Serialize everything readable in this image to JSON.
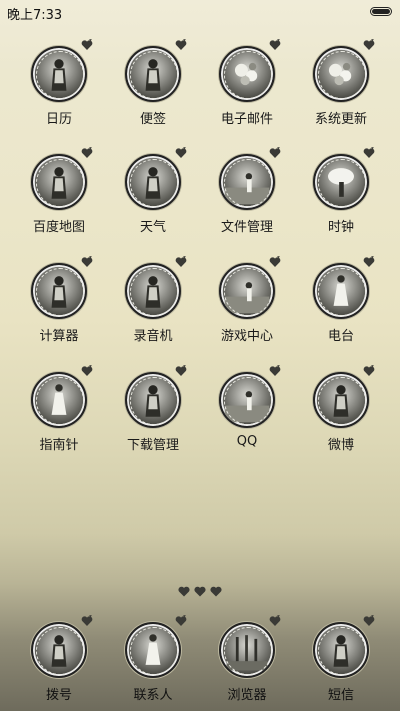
{
  "status_bar": {
    "time": "晚上7:33"
  },
  "apps": [
    {
      "label": "日历",
      "icon": "calendar-icon",
      "photo": "girl-portrait"
    },
    {
      "label": "便签",
      "icon": "notes-icon",
      "photo": "girl-portrait"
    },
    {
      "label": "电子邮件",
      "icon": "email-icon",
      "photo": "flowers"
    },
    {
      "label": "系统更新",
      "icon": "system-update-icon",
      "photo": "flower-closeup"
    },
    {
      "label": "百度地图",
      "icon": "baidu-map-icon",
      "photo": "girl-portrait"
    },
    {
      "label": "天气",
      "icon": "weather-icon",
      "photo": "girl-portrait"
    },
    {
      "label": "文件管理",
      "icon": "file-manager-icon",
      "photo": "girl-field"
    },
    {
      "label": "时钟",
      "icon": "clock-icon",
      "photo": "girl-umbrella"
    },
    {
      "label": "计算器",
      "icon": "calculator-icon",
      "photo": "girl-portrait"
    },
    {
      "label": "录音机",
      "icon": "recorder-icon",
      "photo": "girl-portrait"
    },
    {
      "label": "游戏中心",
      "icon": "game-center-icon",
      "photo": "girl-beach"
    },
    {
      "label": "电台",
      "icon": "radio-icon",
      "photo": "girl-dress"
    },
    {
      "label": "指南针",
      "icon": "compass-icon",
      "photo": "girl-dress"
    },
    {
      "label": "下载管理",
      "icon": "download-manager-icon",
      "photo": "girl-portrait"
    },
    {
      "label": "QQ",
      "icon": "qq-icon",
      "photo": "girl-field"
    },
    {
      "label": "微博",
      "icon": "weibo-icon",
      "photo": "girl-portrait"
    }
  ],
  "dock": [
    {
      "label": "拨号",
      "icon": "dialer-icon",
      "photo": "girl-portrait"
    },
    {
      "label": "联系人",
      "icon": "contacts-icon",
      "photo": "girl-dress"
    },
    {
      "label": "浏览器",
      "icon": "browser-icon",
      "photo": "trees"
    },
    {
      "label": "短信",
      "icon": "messages-icon",
      "photo": "girl-portrait"
    }
  ],
  "page_indicator": {
    "count": 3,
    "current": 1,
    "icon": "heart-icon"
  },
  "colors": {
    "text": "#1a1a1a",
    "ring": "#222222",
    "heart": "#3a3a36"
  }
}
